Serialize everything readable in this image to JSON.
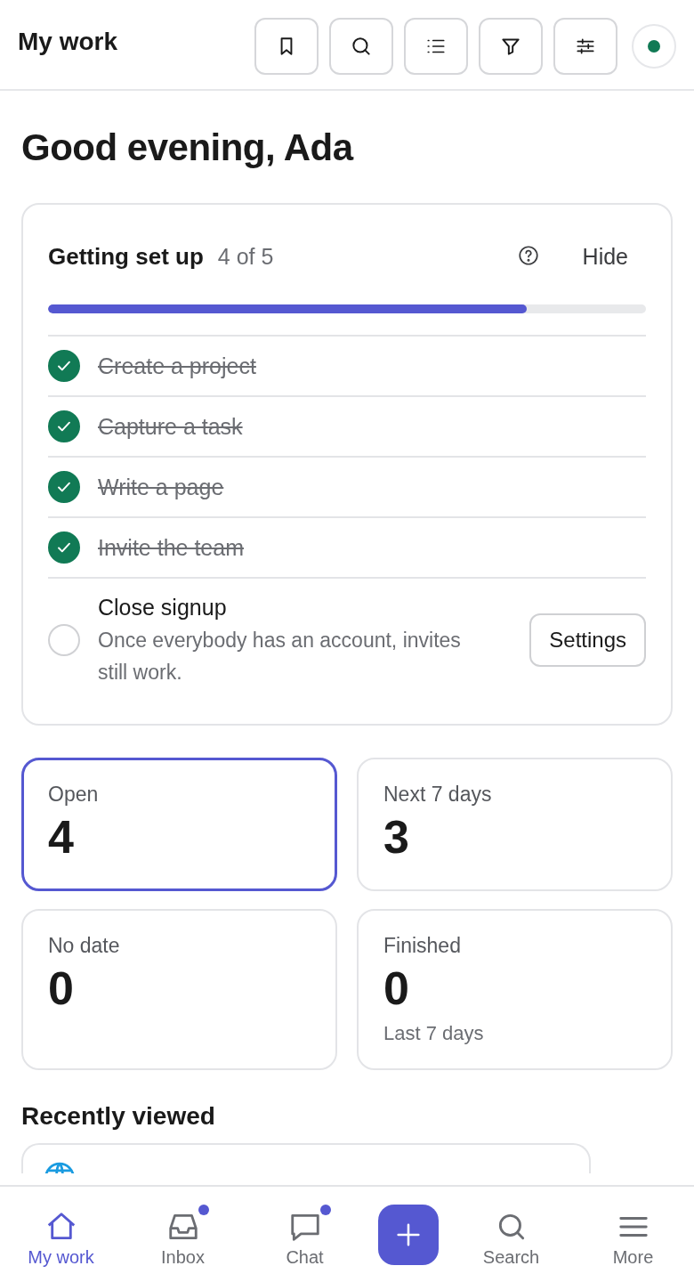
{
  "header": {
    "title": "My work",
    "tools": [
      {
        "kind": "bookmark"
      },
      {
        "kind": "search"
      },
      {
        "kind": "list"
      },
      {
        "kind": "filter"
      },
      {
        "kind": "sliders"
      }
    ],
    "status_online": true
  },
  "greeting": "Good evening, Ada",
  "setup": {
    "title": "Getting set up",
    "count": "4 of 5",
    "hide": "Hide",
    "level": 0.8,
    "steps": [
      {
        "label": "Create a project",
        "checked": true
      },
      {
        "label": "Capture a task",
        "checked": true
      },
      {
        "label": "Write a page",
        "checked": true
      },
      {
        "label": "Invite the team",
        "checked": true
      },
      {
        "label": "Close signup",
        "checked": false,
        "description": "Once everybody has an account, invites still work.",
        "action": "Settings"
      }
    ]
  },
  "stats": [
    {
      "label": "Open",
      "value": "4",
      "selected": true
    },
    {
      "label": "Next 7 days",
      "value": "3",
      "selected": false
    },
    {
      "label": "No date",
      "value": "0",
      "selected": false
    },
    {
      "label": "Finished",
      "value": "0",
      "note": "Last 7 days",
      "selected": false
    }
  ],
  "recent": {
    "title": "Recently viewed",
    "items": [
      {
        "kind": "web"
      }
    ]
  },
  "nav": [
    {
      "kind": "tab",
      "label": "My work",
      "selected": true,
      "dot": false
    },
    {
      "kind": "tab",
      "label": "Inbox",
      "selected": false,
      "dot": true
    },
    {
      "kind": "tab",
      "label": "Chat",
      "selected": false,
      "dot": true
    },
    {
      "kind": "add"
    },
    {
      "kind": "tab",
      "label": "Search",
      "selected": false,
      "dot": false
    },
    {
      "kind": "tab",
      "label": "More",
      "selected": false,
      "dot": false
    }
  ]
}
